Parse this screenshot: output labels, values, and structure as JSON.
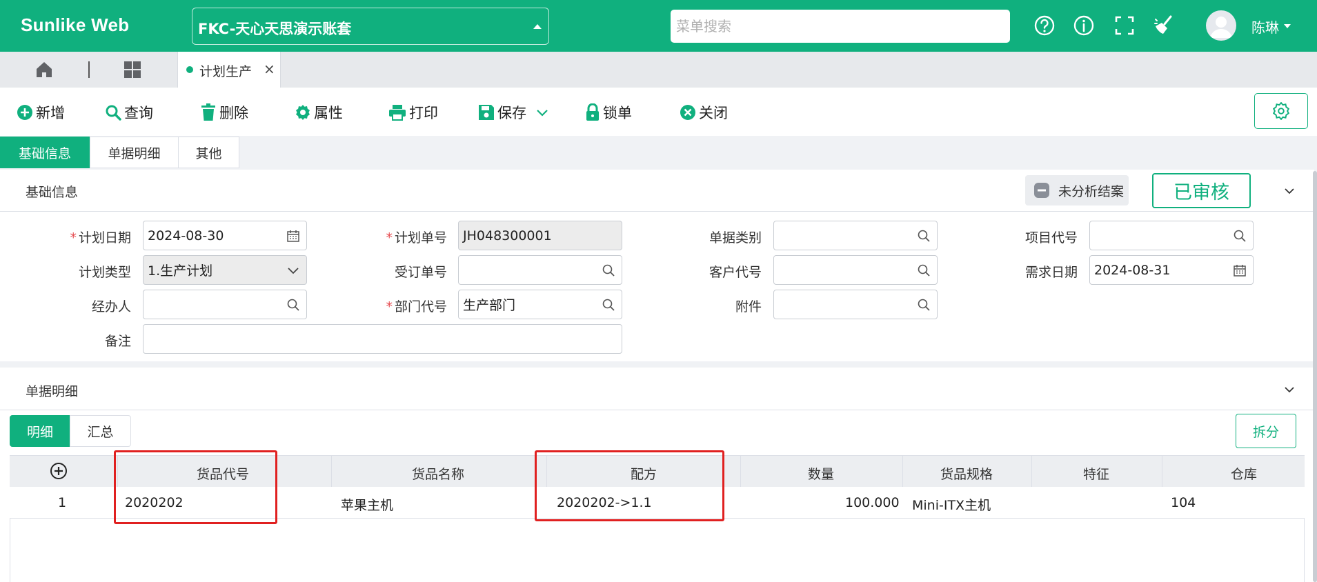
{
  "header": {
    "brand": "Sunlike Web",
    "account": "FKC-天心天思演示账套",
    "search_placeholder": "菜单搜索",
    "user": "陈琳",
    "icons": [
      "help-icon",
      "info-icon",
      "fullscreen-icon",
      "broom-icon"
    ]
  },
  "tabs": {
    "active_label": "计划生产",
    "close_glyph": "×"
  },
  "toolbar": {
    "new": "新增",
    "query": "查询",
    "delete": "删除",
    "property": "属性",
    "print": "打印",
    "save": "保存",
    "lock": "锁单",
    "close": "关闭"
  },
  "section_tabs": [
    "基础信息",
    "单据明细",
    "其他"
  ],
  "basic": {
    "title": "基础信息",
    "unanalyzed": "未分析结案",
    "approved": "已审核",
    "labels": {
      "plan_date": "计划日期",
      "plan_no": "计划单号",
      "doc_type": "单据类别",
      "project_code": "项目代号",
      "plan_type": "计划类型",
      "order_no": "受订单号",
      "customer_code": "客户代号",
      "demand_date": "需求日期",
      "handler": "经办人",
      "dept_code": "部门代号",
      "attachment": "附件",
      "remark": "备注"
    },
    "values": {
      "plan_date": "2024-08-30",
      "plan_no": "JH048300001",
      "plan_type": "1.生产计划",
      "demand_date": "2024-08-31",
      "dept_code": "生产部门"
    }
  },
  "detail": {
    "title": "单据明细",
    "subtabs": [
      "明细",
      "汇总"
    ],
    "split": "拆分",
    "columns": [
      "货品代号",
      "货品名称",
      "配方",
      "数量",
      "货品规格",
      "特征",
      "仓库"
    ],
    "rows": [
      {
        "idx": "1",
        "code": "2020202",
        "name": "苹果主机",
        "recipe": "2020202->1.1",
        "qty": "100.000",
        "spec": "Mini-ITX主机",
        "feature": "",
        "warehouse": "104"
      }
    ]
  },
  "colors": {
    "accent": "#10b07e",
    "highlight": "#e02020"
  }
}
